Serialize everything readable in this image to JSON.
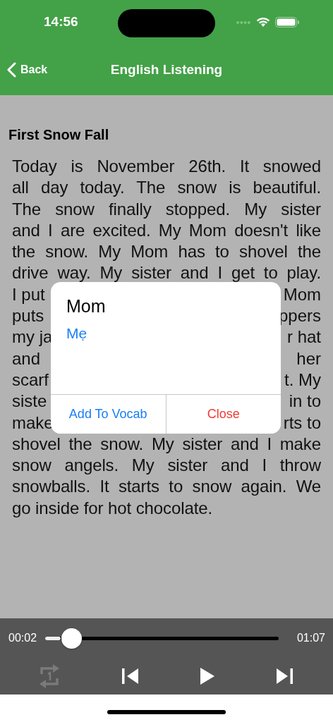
{
  "status_bar": {
    "time": "14:56"
  },
  "nav_bar": {
    "back": "Back",
    "title": "English Listening"
  },
  "story": {
    "title": "First Snow Fall",
    "lines": [
      [
        "Today is November 26th. It snowed"
      ],
      [
        "all day today. The snow is beautiful."
      ],
      [
        "The snow finally stopped. My sister"
      ],
      [
        "and I are excited. My Mom doesn't like"
      ],
      [
        "the snow. My Mom has to shovel the"
      ],
      [
        "drive way. My sister and I get to play."
      ],
      [
        "I put",
        "Mom"
      ],
      [
        "puts",
        "ppers"
      ],
      [
        "my ja",
        "r hat"
      ],
      [
        "and",
        "her"
      ],
      [
        "scarf",
        "t. My"
      ],
      [
        "siste",
        "in to"
      ],
      [
        "make",
        "rts to"
      ],
      [
        "shovel the snow. My sister and I make"
      ],
      [
        "snow angels. My sister and I throw"
      ],
      [
        "snowballs. It starts to snow again. We"
      ],
      [
        "go inside for hot chocolate."
      ]
    ]
  },
  "popup": {
    "word": "Mom",
    "translation": "Mẹ",
    "buttons": [
      {
        "label": "Add To Vocab",
        "kind": "primary"
      },
      {
        "label": "Close",
        "kind": "destructive"
      }
    ]
  },
  "player": {
    "elapsed": "00:02",
    "duration": "01:07",
    "level": 0.066,
    "repeat_one_on": false
  }
}
